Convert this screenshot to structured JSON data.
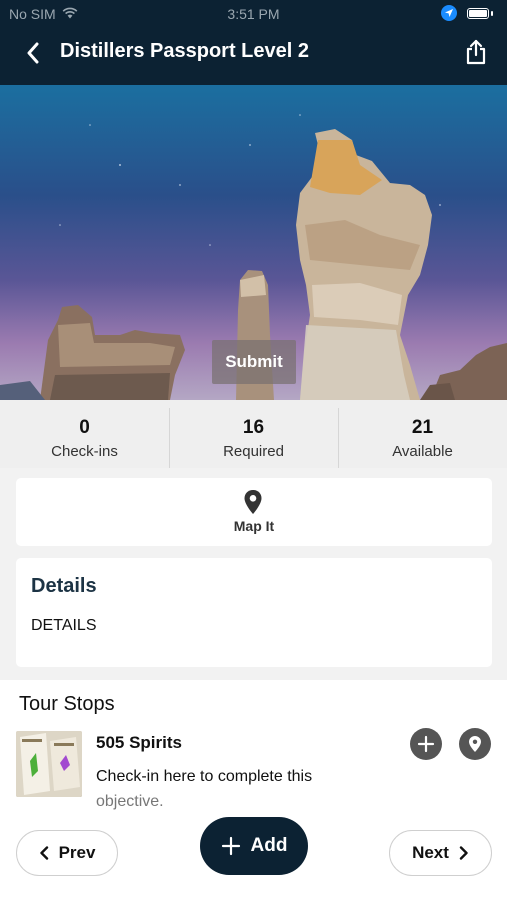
{
  "status_bar": {
    "carrier": "No SIM",
    "time": "3:51 PM"
  },
  "header": {
    "title": "Distillers Passport Level 2",
    "back_icon": "chevron-left-icon",
    "share_icon": "share-icon"
  },
  "hero": {
    "submit_label": "Submit"
  },
  "stats": [
    {
      "value": "0",
      "label": "Check-ins"
    },
    {
      "value": "16",
      "label": "Required"
    },
    {
      "value": "21",
      "label": "Available"
    }
  ],
  "map_it": {
    "label": "Map It",
    "icon": "map-pin-icon"
  },
  "details": {
    "heading": "Details",
    "body": "DETAILS"
  },
  "tour_stops": {
    "heading": "Tour Stops",
    "items": [
      {
        "name": "505 Spirits",
        "description": "Check-in here to complete this",
        "description_faded": "objective."
      }
    ]
  },
  "footer": {
    "prev_label": "Prev",
    "add_label": "Add",
    "next_label": "Next"
  },
  "colors": {
    "header_bg": "#0c2233",
    "add_button_bg": "#0c2233",
    "icon_button_bg": "#555555"
  }
}
